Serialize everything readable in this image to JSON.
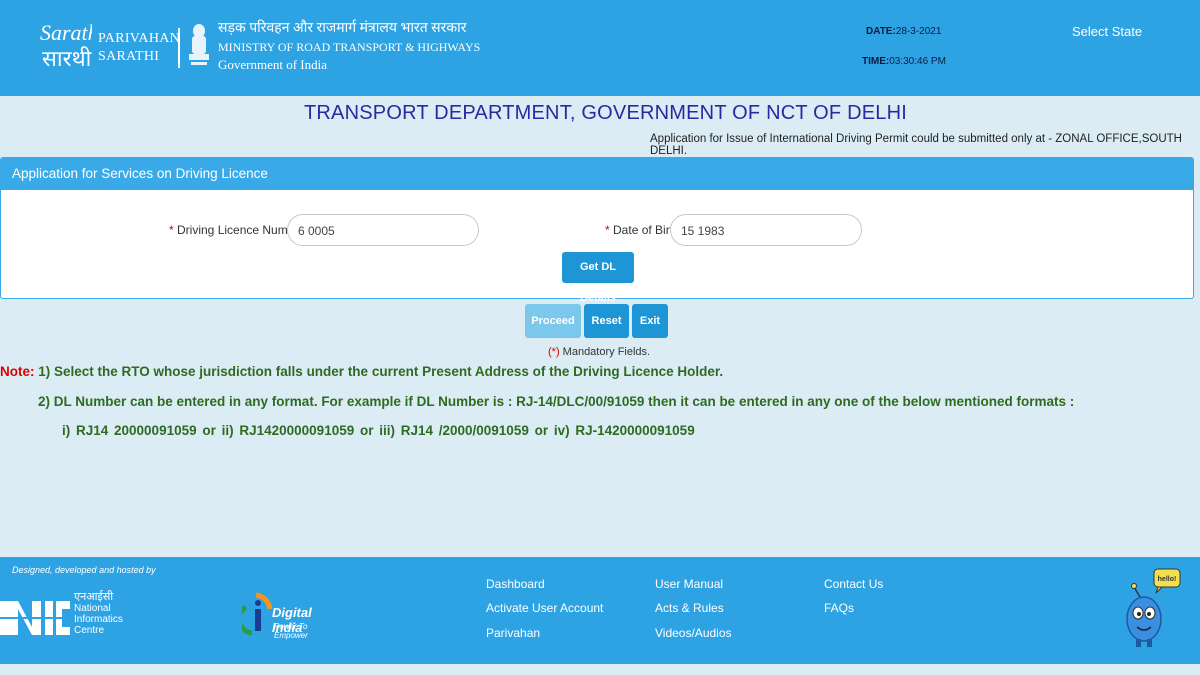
{
  "header": {
    "brand_line1": "PARIVAHAN",
    "brand_line2": "SARATHI",
    "ministry_hindi": "सड़क परिवहन और राजमार्ग मंत्रालय भारत सरकार",
    "ministry_english": "MINISTRY OF ROAD TRANSPORT & HIGHWAYS",
    "government": "Government of India",
    "date_label": "DATE:",
    "date_value": "28-3-2021",
    "time_label": "TIME:",
    "time_value": "03:30:46 PM",
    "select_state": "Select State"
  },
  "title": {
    "main": "TRANSPORT DEPARTMENT, GOVERNMENT OF NCT OF DELHI",
    "note": "Application for Issue of International Driving Permit could be submitted only at - ZONAL OFFICE,SOUTH DELHI."
  },
  "form": {
    "heading": "Application for Services on Driving Licence",
    "required_marker": "*",
    "dl_label": "Driving Licence Number",
    "dl_value": "  6   0005",
    "dob_label": "Date of Birth",
    "dob_value": "15   1983",
    "get_dl_button": "Get DL Details"
  },
  "actions": {
    "proceed": "Proceed",
    "reset": "Reset",
    "exit": "Exit",
    "mandatory_prefix": "(*)",
    "mandatory_text": " Mandatory Fields."
  },
  "notes": {
    "label": "Note:",
    "line1": " 1) Select the RTO whose jurisdiction falls under the current Present Address of the Driving Licence Holder.",
    "line2": "2) DL Number can be entered in any format. For example if DL Number is : RJ-14/DLC/00/91059 then it can be entered in any one of the below mentioned formats :",
    "line3": "i) RJ14 20000091059    or    ii) RJ1420000091059    or    iii) RJ14 /2000/0091059    or    iv) RJ-1420000091059"
  },
  "footer": {
    "designed_by": "Designed, developed and hosted by",
    "nic_hindi": "एनआईसी",
    "nic_line1": "National",
    "nic_line2": "Informatics",
    "nic_line3": "Centre",
    "digital_india": "Digital India",
    "digital_india_tag": "Power To Empower",
    "links_col1": [
      "Dashboard",
      "Activate User Account",
      "Parivahan"
    ],
    "links_col2": [
      "User Manual",
      "Acts & Rules",
      "Videos/Audios"
    ],
    "links_col3": [
      "Contact Us",
      "FAQs"
    ],
    "mascot_bubble": "hello!"
  },
  "colors": {
    "header_blue": "#2ea3e4",
    "page_bg": "#dcecf4",
    "title_color": "#2a2aa0",
    "note_green": "#2d6b22",
    "required_red": "#dd0000"
  }
}
